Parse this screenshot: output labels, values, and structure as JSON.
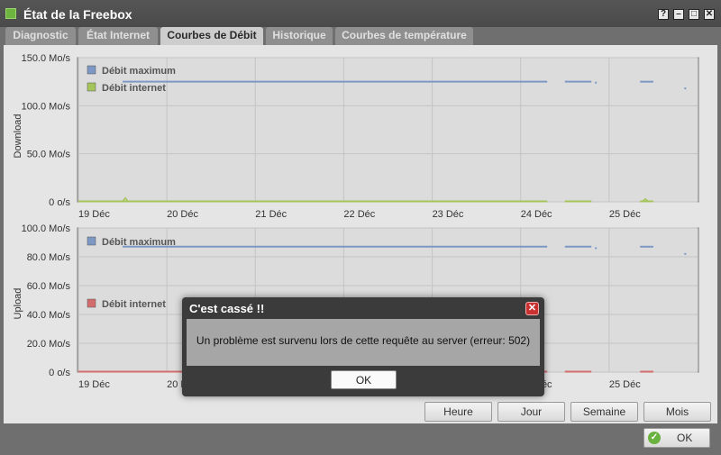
{
  "window": {
    "title": "État de la Freebox",
    "buttons": [
      "?",
      "–",
      "□",
      "✕"
    ]
  },
  "tabs": [
    {
      "label": "Diagnostic",
      "active": false
    },
    {
      "label": "État Internet",
      "active": false
    },
    {
      "label": "Courbes de Débit",
      "active": true
    },
    {
      "label": "Historique",
      "active": false
    },
    {
      "label": "Courbes de température",
      "active": false
    }
  ],
  "chart_data": [
    {
      "type": "line",
      "ylabel": "Download",
      "yticks": [
        "150.0 Mo/s",
        "100.0 Mo/s",
        "50.0 Mo/s",
        "0 o/s"
      ],
      "ylim": [
        0,
        150
      ],
      "xticks": [
        "19 Déc",
        "20 Déc",
        "21 Déc",
        "22 Déc",
        "23 Déc",
        "24 Déc",
        "25 Déc"
      ],
      "grid": true,
      "legend_position": "top-left",
      "series": [
        {
          "name": "Débit maximum",
          "color": "#7d98c4",
          "segments": [
            [
              19.5,
              24.3,
              125
            ],
            [
              24.5,
              24.8,
              125
            ],
            [
              24.84,
              24.86,
              124
            ],
            [
              25.35,
              25.5,
              125
            ],
            [
              25.85,
              25.86,
              118
            ]
          ]
        },
        {
          "name": "Débit internet",
          "color": "#a5c55a",
          "segments": [
            [
              19.0,
              24.3,
              0.5
            ],
            [
              24.5,
              24.8,
              0.5
            ],
            [
              25.35,
              25.5,
              0.5
            ]
          ],
          "spikes": [
            [
              19.53,
              4
            ],
            [
              25.41,
              3
            ]
          ]
        }
      ]
    },
    {
      "type": "line",
      "ylabel": "Upload",
      "yticks": [
        "100.0 Mo/s",
        "80.0 Mo/s",
        "60.0 Mo/s",
        "40.0 Mo/s",
        "20.0 Mo/s",
        "0 o/s"
      ],
      "ylim": [
        0,
        100
      ],
      "xticks": [
        "19 Déc",
        "20 Déc",
        "21 Déc",
        "22 Déc",
        "23 Déc",
        "24 Déc",
        "25 Déc"
      ],
      "grid": true,
      "legend_position": "top-left",
      "series": [
        {
          "name": "Débit maximum",
          "color": "#7d98c4",
          "segments": [
            [
              19.5,
              24.3,
              87
            ],
            [
              24.5,
              24.8,
              87
            ],
            [
              24.84,
              24.86,
              86
            ],
            [
              25.35,
              25.5,
              87
            ],
            [
              25.85,
              25.86,
              82
            ]
          ]
        },
        {
          "name": "Débit internet",
          "color": "#d36c6c",
          "segments": [
            [
              19.0,
              24.3,
              0.3
            ],
            [
              24.5,
              24.8,
              0.3
            ],
            [
              25.35,
              25.5,
              0.3
            ]
          ],
          "spikes": []
        }
      ]
    }
  ],
  "range_buttons": [
    "Heure",
    "Jour",
    "Semaine",
    "Mois"
  ],
  "ok_button": "OK",
  "dialog": {
    "title": "C'est cassé !!",
    "message": "Un problème est survenu lors de cette requête au server (erreur: 502)",
    "ok": "OK"
  }
}
